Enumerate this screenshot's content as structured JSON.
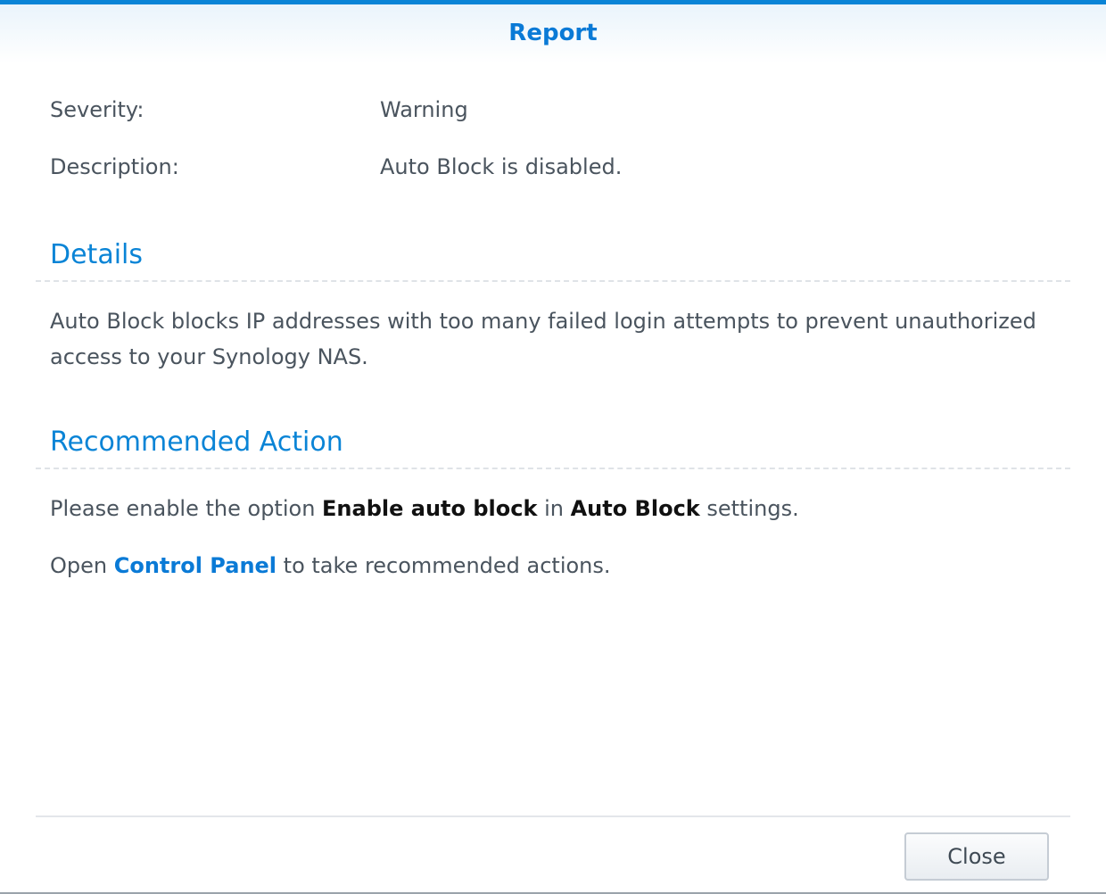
{
  "dialog": {
    "title": "Report",
    "accent_color": "#0a84d6"
  },
  "summary": {
    "severity_label": "Severity:",
    "severity_value": "Warning",
    "description_label": "Description:",
    "description_value": "Auto Block is disabled."
  },
  "details": {
    "heading": "Details",
    "text": "Auto Block blocks IP addresses with too many failed login attempts to prevent unauthorized access to your Synology NAS."
  },
  "recommended": {
    "heading": "Recommended Action",
    "line1_prefix": "Please enable the option ",
    "line1_bold1": "Enable auto block",
    "line1_middle": " in ",
    "line1_bold2": "Auto Block",
    "line1_suffix": " settings.",
    "line2_prefix": "Open ",
    "line2_link": "Control Panel",
    "line2_suffix": " to take recommended actions."
  },
  "footer": {
    "close_label": "Close"
  }
}
